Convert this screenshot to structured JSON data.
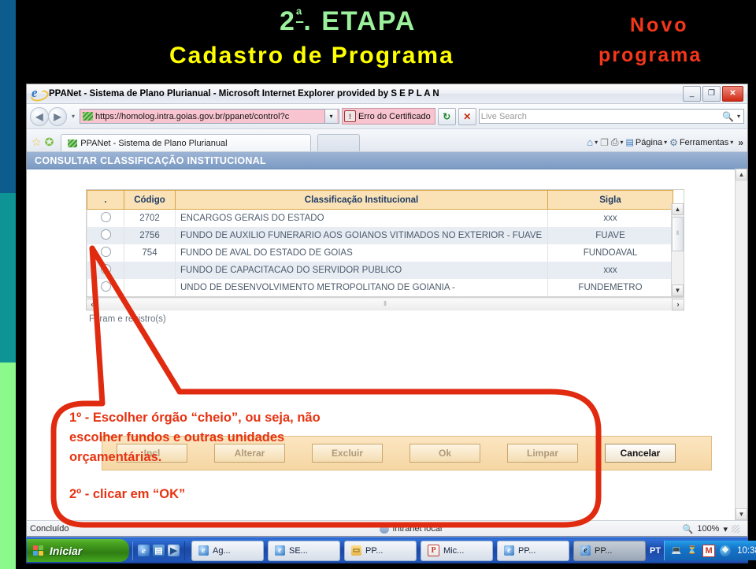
{
  "slide": {
    "title_stage": "2ª. ETAPA",
    "title_stage_num": "2",
    "title_stage_ord": "ª",
    "title_stage_rest": ". ETAPA",
    "title_main": "Cadastro de Programa",
    "label_right_line1": "Novo",
    "label_right_line2": "programa",
    "colors": {
      "stage": "#9bf09b",
      "main": "#ffff00",
      "right": "#f4371b",
      "annotation": "#e63312",
      "strip_blue": "#0d5c8e",
      "strip_teal": "#0e9494",
      "strip_green": "#8cf98c"
    }
  },
  "browser": {
    "window_title": "PPANet - Sistema de Plano Plurianual - Microsoft Internet Explorer provided by S E P L A N",
    "window_buttons": {
      "minimize": "_",
      "restore": "❐",
      "close": "✕"
    },
    "nav": {
      "back": "◀",
      "forward": "▶",
      "history_caret": "▾"
    },
    "address": {
      "url": "https://homolog.intra.goias.gov.br/ppanet/control?c",
      "dropdown_caret": "▾",
      "certificate_error": "Erro do Certificado",
      "refresh": "↻",
      "stop": "✕"
    },
    "search": {
      "placeholder": "Live Search",
      "icon": "search-icon",
      "caret": "▾"
    },
    "favorites": {
      "add": "☆",
      "center": "✪"
    },
    "tabs": [
      {
        "label": "PPANet - Sistema de Plano Plurianual",
        "active": true
      },
      {
        "label": "",
        "active": false
      }
    ],
    "command_bar": {
      "home": "⌂",
      "feeds": "❐",
      "print": "⎙",
      "page": "Página",
      "tools": "Ferramentas",
      "overflow": "»",
      "caret": "▾"
    },
    "status": {
      "left": "Concluído",
      "zone": "Intranet local",
      "zoom": "100%",
      "zoom_caret": "▾"
    }
  },
  "page": {
    "header": "CONSULTAR CLASSIFICAÇÃO INSTITUCIONAL",
    "table": {
      "columns": [
        ".",
        "Código",
        "Classificação Institucional",
        "Sigla"
      ],
      "rows": [
        {
          "select": "○",
          "codigo": "2702",
          "descricao": "ENCARGOS GERAIS DO ESTADO",
          "sigla": "xxx"
        },
        {
          "select": "○",
          "codigo": "2756",
          "descricao": "FUNDO DE AUXILIO FUNERARIO AOS GOIANOS VITIMADOS NO EXTERIOR - FUAVE",
          "sigla": "FUAVE"
        },
        {
          "select": "○",
          "codigo": "754",
          "descricao": "FUNDO DE AVAL DO ESTADO DE GOIAS",
          "sigla": "FUNDOAVAL"
        },
        {
          "select": "○",
          "codigo": "",
          "descricao": "FUNDO DE CAPACITACAO DO SERVIDOR PUBLICO",
          "sigla": "xxx"
        },
        {
          "select": "○",
          "codigo": "",
          "descricao": "UNDO DE DESENVOLVIMENTO METROPOLITANO DE GOIANIA -",
          "sigla": "FUNDEMETRO"
        }
      ],
      "scroll_up": "▲",
      "scroll_down": "▼",
      "scroll_left": "‹",
      "scroll_right": "›",
      "thumb_grip": "⦀"
    },
    "records_text": "Foram e                      registro(s)",
    "buttons": [
      {
        "label": "Incl",
        "enabled": false
      },
      {
        "label": "Alterar",
        "enabled": false
      },
      {
        "label": "Excluir",
        "enabled": false
      },
      {
        "label": "Ok",
        "enabled": false
      },
      {
        "label": "Limpar",
        "enabled": false
      },
      {
        "label": "Cancelar",
        "enabled": true
      }
    ]
  },
  "annotation": {
    "line1": "1º - Escolher órgão “cheio”, ou seja, não",
    "line2": "escolher fundos e outras unidades",
    "line3": "orçamentárias.",
    "line4": "2º - clicar em “OK”"
  },
  "taskbar": {
    "start": "Iniciar",
    "quick_launch": [
      "ie-icon",
      "show-desktop-icon",
      "media-player-icon"
    ],
    "tasks": [
      {
        "label": "Ag...",
        "icon": "ie-icon",
        "active": false
      },
      {
        "label": "SE...",
        "icon": "ie-icon",
        "active": false
      },
      {
        "label": "PP...",
        "icon": "folder-icon",
        "active": false
      },
      {
        "label": "Mic...",
        "icon": "powerpoint-icon",
        "active": false
      },
      {
        "label": "PP...",
        "icon": "ie-icon",
        "active": false
      },
      {
        "label": "PP...",
        "icon": "ie-icon",
        "active": true
      }
    ],
    "language": "PT",
    "tray_icons": [
      "network-icon",
      "clock-icon",
      "mcafee-icon",
      "bluetooth-icon"
    ],
    "clock": "10:38"
  }
}
